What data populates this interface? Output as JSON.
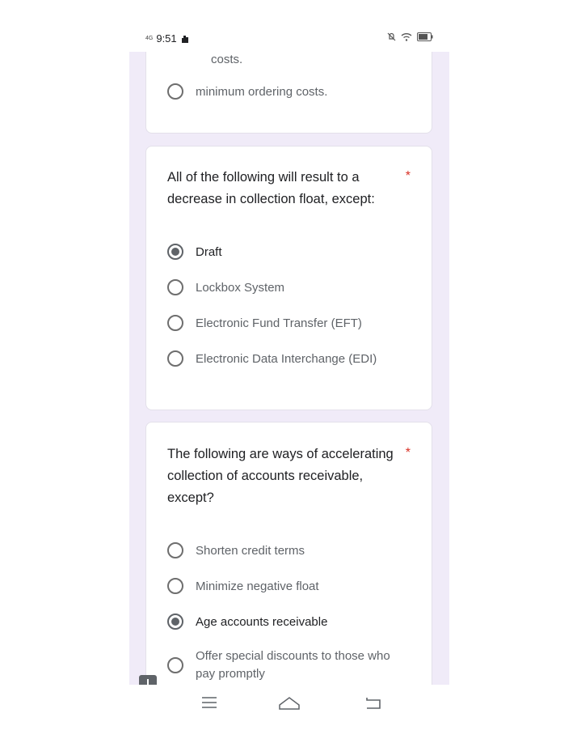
{
  "status_bar": {
    "network": "4G",
    "time": "9:51"
  },
  "prev_card": {
    "cut_text": "costs.",
    "option": "minimum ordering costs."
  },
  "q1": {
    "title": "All of the following will result to a decrease in collection float, except:",
    "required_mark": "*",
    "options": [
      "Draft",
      "Lockbox System",
      "Electronic Fund Transfer (EFT)",
      "Electronic Data Interchange (EDI)"
    ],
    "selected": "Draft"
  },
  "q2": {
    "title": "The following are ways of accelerating collection of accounts receivable, except?",
    "required_mark": "*",
    "options": [
      "Shorten credit terms",
      "Minimize negative float",
      "Age accounts receivable",
      "Offer special discounts to those who pay promptly"
    ],
    "selected": "Age accounts receivable"
  },
  "icons": {
    "feedback": "feedback-icon",
    "nav_menu": "menu-icon",
    "nav_home": "home-icon",
    "nav_back": "back-icon"
  }
}
